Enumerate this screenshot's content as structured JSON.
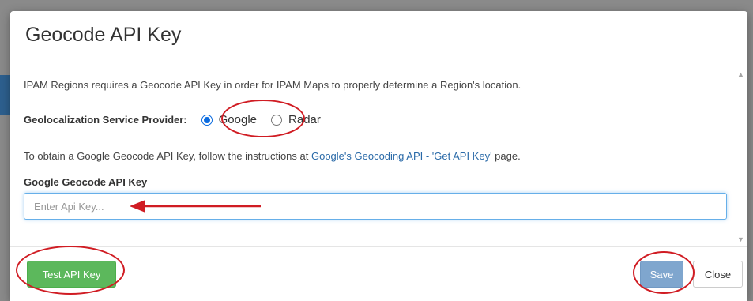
{
  "dialog": {
    "title": "Geocode API Key",
    "intro": "IPAM Regions requires a Geocode API Key in order for IPAM Maps to properly determine a Region's location.",
    "provider": {
      "label": "Geolocalization Service Provider:",
      "options": [
        {
          "label": "Google",
          "checked": true
        },
        {
          "label": "Radar",
          "checked": false
        }
      ]
    },
    "instructions": {
      "prefix": "To obtain a Google Geocode API Key, follow the instructions at ",
      "link": "Google's Geocoding API - 'Get API Key'",
      "suffix": " page."
    },
    "api_key": {
      "label": "Google Geocode API Key",
      "value": "",
      "placeholder": "Enter Api Key..."
    },
    "footer": {
      "test_label": "Test API Key",
      "save_label": "Save",
      "close_label": "Close"
    }
  },
  "colors": {
    "annotation": "#d01c23",
    "success": "#5cb85c",
    "primary_disabled": "#7fa6ce",
    "link": "#2a6aa8"
  },
  "icons": {
    "scroll_up": "triangle-up-icon",
    "scroll_down": "triangle-down-icon"
  }
}
